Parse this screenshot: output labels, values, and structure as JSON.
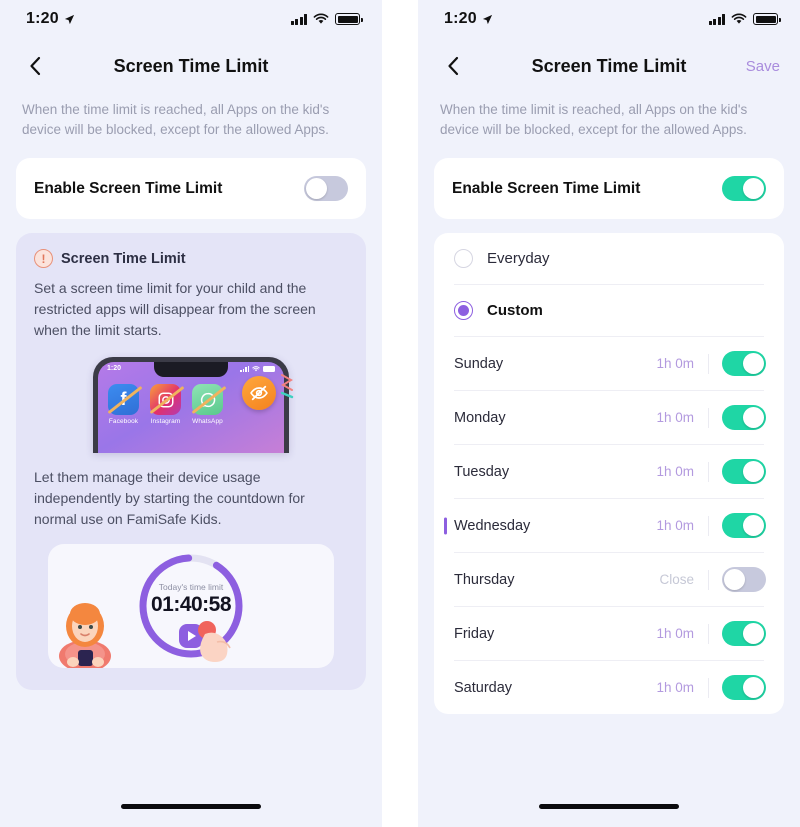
{
  "status_bar": {
    "time": "1:20",
    "location_icon": "location-arrow-icon",
    "signal_icon": "cellular-signal-icon",
    "wifi_icon": "wifi-icon",
    "battery_icon": "battery-full-icon"
  },
  "colors": {
    "background": "#f0f2fb",
    "card": "#ffffff",
    "info_card": "#e4e4f7",
    "accent_purple": "#8d5fe0",
    "save_purple": "#a98cdd",
    "toggle_on": "#1fd6a5",
    "toggle_off": "#c7c9dd",
    "value_purple": "#b39adf",
    "muted_text": "#9a9db0",
    "warn_orange": "#e0775c"
  },
  "left_screen": {
    "nav": {
      "back_icon": "chevron-left-icon",
      "title": "Screen Time Limit"
    },
    "description": "When the time limit is reached, all Apps on the kid's device will be blocked, except for the allowed Apps.",
    "enable_row": {
      "label": "Enable Screen Time Limit",
      "toggle_state": "off"
    },
    "info_card": {
      "icon": "exclamation-circle-icon",
      "title": "Screen Time Limit",
      "body": "Set a screen time limit for your child and the restricted apps will disappear from the screen when the limit starts.",
      "footer": "Let them manage their device usage independently by starting the countdown for normal use on FamiSafe Kids.",
      "phone_mockup": {
        "status_time": "1:20",
        "apps": [
          {
            "name": "Facebook",
            "glyph": "f",
            "style": "fb"
          },
          {
            "name": "Instagram",
            "glyph": "◎",
            "style": "ig"
          },
          {
            "name": "WhatsApp",
            "glyph": "○",
            "style": "wa"
          }
        ],
        "badge_icon": "eye-off-icon"
      },
      "timer": {
        "label": "Today's time limit",
        "value": "01:40:58",
        "play_icon": "play-button-icon",
        "girl_illustration": "child-with-phone-illustration",
        "hand_illustration": "pointing-hand-illustration"
      }
    }
  },
  "right_screen": {
    "nav": {
      "back_icon": "chevron-left-icon",
      "title": "Screen Time Limit",
      "save_label": "Save"
    },
    "description": "When the time limit is reached, all Apps on the kid's device will be blocked, except for the allowed Apps.",
    "enable_row": {
      "label": "Enable Screen Time Limit",
      "toggle_state": "on"
    },
    "schedule": {
      "modes": [
        {
          "label": "Everyday",
          "selected": false
        },
        {
          "label": "Custom",
          "selected": true
        }
      ],
      "days": [
        {
          "name": "Sunday",
          "value": "1h 0m",
          "toggle_state": "on",
          "marked": false
        },
        {
          "name": "Monday",
          "value": "1h 0m",
          "toggle_state": "on",
          "marked": false
        },
        {
          "name": "Tuesday",
          "value": "1h 0m",
          "toggle_state": "on",
          "marked": false
        },
        {
          "name": "Wednesday",
          "value": "1h 0m",
          "toggle_state": "on",
          "marked": true
        },
        {
          "name": "Thursday",
          "value": "Close",
          "toggle_state": "off",
          "marked": false
        },
        {
          "name": "Friday",
          "value": "1h 0m",
          "toggle_state": "on",
          "marked": false
        },
        {
          "name": "Saturday",
          "value": "1h 0m",
          "toggle_state": "on",
          "marked": false
        }
      ]
    }
  }
}
